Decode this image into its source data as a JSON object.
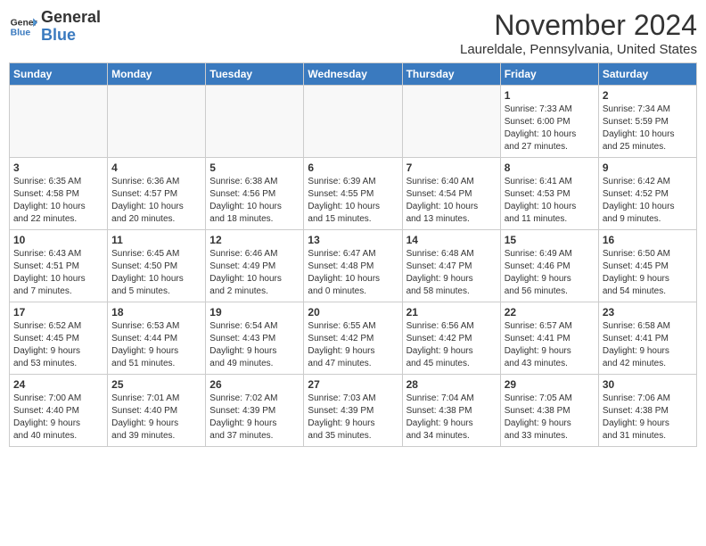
{
  "header": {
    "logo_general": "General",
    "logo_blue": "Blue",
    "month": "November 2024",
    "location": "Laureldale, Pennsylvania, United States"
  },
  "weekdays": [
    "Sunday",
    "Monday",
    "Tuesday",
    "Wednesday",
    "Thursday",
    "Friday",
    "Saturday"
  ],
  "weeks": [
    [
      {
        "day": "",
        "info": ""
      },
      {
        "day": "",
        "info": ""
      },
      {
        "day": "",
        "info": ""
      },
      {
        "day": "",
        "info": ""
      },
      {
        "day": "",
        "info": ""
      },
      {
        "day": "1",
        "info": "Sunrise: 7:33 AM\nSunset: 6:00 PM\nDaylight: 10 hours\nand 27 minutes."
      },
      {
        "day": "2",
        "info": "Sunrise: 7:34 AM\nSunset: 5:59 PM\nDaylight: 10 hours\nand 25 minutes."
      }
    ],
    [
      {
        "day": "3",
        "info": "Sunrise: 6:35 AM\nSunset: 4:58 PM\nDaylight: 10 hours\nand 22 minutes."
      },
      {
        "day": "4",
        "info": "Sunrise: 6:36 AM\nSunset: 4:57 PM\nDaylight: 10 hours\nand 20 minutes."
      },
      {
        "day": "5",
        "info": "Sunrise: 6:38 AM\nSunset: 4:56 PM\nDaylight: 10 hours\nand 18 minutes."
      },
      {
        "day": "6",
        "info": "Sunrise: 6:39 AM\nSunset: 4:55 PM\nDaylight: 10 hours\nand 15 minutes."
      },
      {
        "day": "7",
        "info": "Sunrise: 6:40 AM\nSunset: 4:54 PM\nDaylight: 10 hours\nand 13 minutes."
      },
      {
        "day": "8",
        "info": "Sunrise: 6:41 AM\nSunset: 4:53 PM\nDaylight: 10 hours\nand 11 minutes."
      },
      {
        "day": "9",
        "info": "Sunrise: 6:42 AM\nSunset: 4:52 PM\nDaylight: 10 hours\nand 9 minutes."
      }
    ],
    [
      {
        "day": "10",
        "info": "Sunrise: 6:43 AM\nSunset: 4:51 PM\nDaylight: 10 hours\nand 7 minutes."
      },
      {
        "day": "11",
        "info": "Sunrise: 6:45 AM\nSunset: 4:50 PM\nDaylight: 10 hours\nand 5 minutes."
      },
      {
        "day": "12",
        "info": "Sunrise: 6:46 AM\nSunset: 4:49 PM\nDaylight: 10 hours\nand 2 minutes."
      },
      {
        "day": "13",
        "info": "Sunrise: 6:47 AM\nSunset: 4:48 PM\nDaylight: 10 hours\nand 0 minutes."
      },
      {
        "day": "14",
        "info": "Sunrise: 6:48 AM\nSunset: 4:47 PM\nDaylight: 9 hours\nand 58 minutes."
      },
      {
        "day": "15",
        "info": "Sunrise: 6:49 AM\nSunset: 4:46 PM\nDaylight: 9 hours\nand 56 minutes."
      },
      {
        "day": "16",
        "info": "Sunrise: 6:50 AM\nSunset: 4:45 PM\nDaylight: 9 hours\nand 54 minutes."
      }
    ],
    [
      {
        "day": "17",
        "info": "Sunrise: 6:52 AM\nSunset: 4:45 PM\nDaylight: 9 hours\nand 53 minutes."
      },
      {
        "day": "18",
        "info": "Sunrise: 6:53 AM\nSunset: 4:44 PM\nDaylight: 9 hours\nand 51 minutes."
      },
      {
        "day": "19",
        "info": "Sunrise: 6:54 AM\nSunset: 4:43 PM\nDaylight: 9 hours\nand 49 minutes."
      },
      {
        "day": "20",
        "info": "Sunrise: 6:55 AM\nSunset: 4:42 PM\nDaylight: 9 hours\nand 47 minutes."
      },
      {
        "day": "21",
        "info": "Sunrise: 6:56 AM\nSunset: 4:42 PM\nDaylight: 9 hours\nand 45 minutes."
      },
      {
        "day": "22",
        "info": "Sunrise: 6:57 AM\nSunset: 4:41 PM\nDaylight: 9 hours\nand 43 minutes."
      },
      {
        "day": "23",
        "info": "Sunrise: 6:58 AM\nSunset: 4:41 PM\nDaylight: 9 hours\nand 42 minutes."
      }
    ],
    [
      {
        "day": "24",
        "info": "Sunrise: 7:00 AM\nSunset: 4:40 PM\nDaylight: 9 hours\nand 40 minutes."
      },
      {
        "day": "25",
        "info": "Sunrise: 7:01 AM\nSunset: 4:40 PM\nDaylight: 9 hours\nand 39 minutes."
      },
      {
        "day": "26",
        "info": "Sunrise: 7:02 AM\nSunset: 4:39 PM\nDaylight: 9 hours\nand 37 minutes."
      },
      {
        "day": "27",
        "info": "Sunrise: 7:03 AM\nSunset: 4:39 PM\nDaylight: 9 hours\nand 35 minutes."
      },
      {
        "day": "28",
        "info": "Sunrise: 7:04 AM\nSunset: 4:38 PM\nDaylight: 9 hours\nand 34 minutes."
      },
      {
        "day": "29",
        "info": "Sunrise: 7:05 AM\nSunset: 4:38 PM\nDaylight: 9 hours\nand 33 minutes."
      },
      {
        "day": "30",
        "info": "Sunrise: 7:06 AM\nSunset: 4:38 PM\nDaylight: 9 hours\nand 31 minutes."
      }
    ]
  ]
}
